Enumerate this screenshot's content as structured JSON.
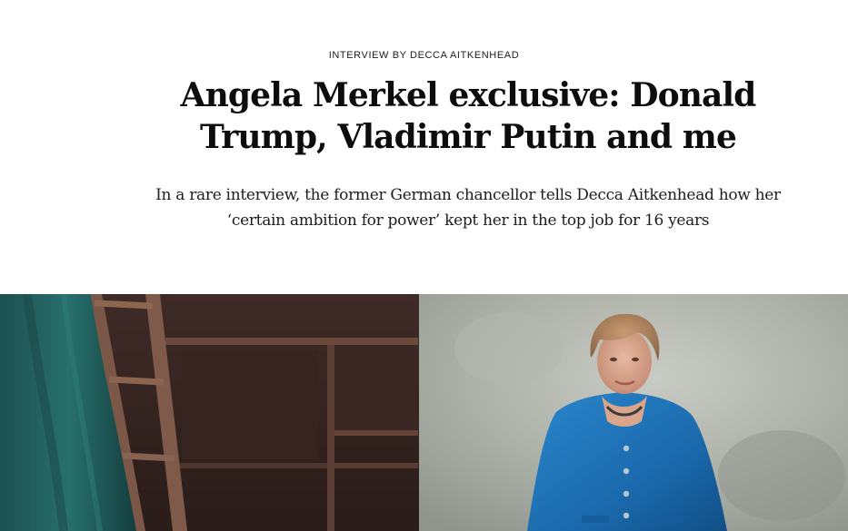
{
  "article": {
    "kicker": "INTERVIEW BY DECCA AITKENHEAD",
    "headline": "Angela Merkel exclusive: Donald Trump, Vladimir Putin and me",
    "standfirst": "In a rare interview, the former German chancellor tells Decca Aitkenhead how her ‘certain ambition for power’ kept her in the top job for 16 years"
  },
  "colors": {
    "background": "#ffffff",
    "text": "#0d0d0d",
    "jacket_blue": "#1d6fb3",
    "curtain_teal": "#1e5a5a",
    "studio_wall": "#a8aca4"
  },
  "image": {
    "description_icon": "portrait-photo"
  }
}
